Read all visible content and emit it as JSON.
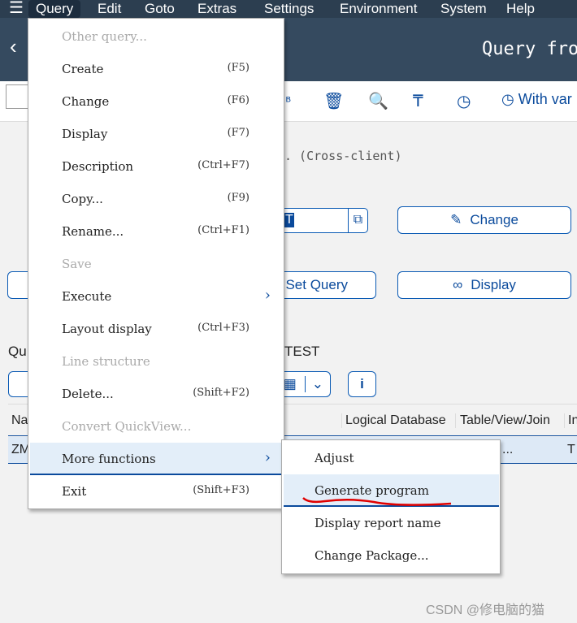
{
  "menubar": {
    "items": [
      "Query",
      "Edit",
      "Goto",
      "Extras",
      "Settings",
      "Environment",
      "System",
      "Help"
    ]
  },
  "title": "Query fro",
  "toolbar": {
    "with_variant": "With var"
  },
  "content": {
    "cross_client": ". (Cross-client)",
    "query_field_value": "T",
    "change_label": "Change",
    "set_query_label": "Set Query",
    "display_label": "Display",
    "section_left": "Qu",
    "section_right": "TEST"
  },
  "table": {
    "headers": [
      "Na",
      "Logical Database",
      "Table/View/Join",
      "In"
    ],
    "row": [
      "ZM",
      "...",
      "T"
    ]
  },
  "query_menu": {
    "items": [
      {
        "label": "Other query...",
        "shortcut": "",
        "disabled": true
      },
      {
        "label": "Create",
        "shortcut": "(F5)"
      },
      {
        "label": "Change",
        "shortcut": "(F6)"
      },
      {
        "label": "Display",
        "shortcut": "(F7)"
      },
      {
        "label": "Description",
        "shortcut": "(Ctrl+F7)"
      },
      {
        "label": "Copy...",
        "shortcut": "(F9)"
      },
      {
        "label": "Rename...",
        "shortcut": "(Ctrl+F1)"
      },
      {
        "label": "Save",
        "shortcut": "",
        "disabled": true
      },
      {
        "label": "Execute",
        "shortcut": "",
        "submenu": true
      },
      {
        "label": "Layout display",
        "shortcut": "(Ctrl+F3)"
      },
      {
        "label": "Line structure",
        "shortcut": "",
        "disabled": true
      },
      {
        "label": "Delete...",
        "shortcut": "(Shift+F2)"
      },
      {
        "label": "Convert QuickView...",
        "shortcut": "",
        "disabled": true
      },
      {
        "label": "More functions",
        "shortcut": "",
        "submenu": true,
        "highlighted": true
      },
      {
        "label": "Exit",
        "shortcut": "(Shift+F3)"
      }
    ]
  },
  "more_functions_menu": {
    "items": [
      {
        "label": "Adjust"
      },
      {
        "label": "Generate program",
        "highlighted": true,
        "annotated": true
      },
      {
        "label": "Display report name"
      },
      {
        "label": "Change Package..."
      }
    ]
  },
  "watermark": "CSDN @修电脑的猫",
  "colors": {
    "shell": "#354a5f",
    "accent": "#0a4a9c",
    "annotation": "#e00000"
  }
}
